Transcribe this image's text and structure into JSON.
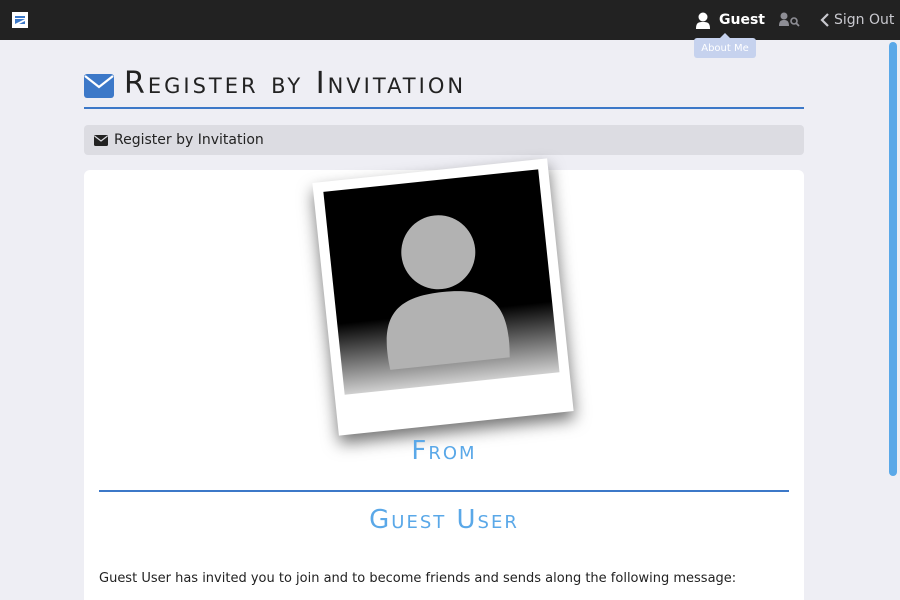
{
  "navbar": {
    "user_label": "Guest",
    "signout_label": "Sign Out",
    "tooltip": "About Me"
  },
  "page": {
    "title": "Register by Invitation",
    "breadcrumb": "Register by Invitation"
  },
  "invite": {
    "from_label": "From",
    "sender_name": "Guest User",
    "message": "Guest User has invited you to join and to become friends and sends along the following message:"
  },
  "colors": {
    "accent": "#3c78c8",
    "heading_blue": "#5aa8e8",
    "navbar": "#222222"
  },
  "icons": {
    "logo": "app-logo-icon",
    "user": "user-icon",
    "search_user": "user-search-icon",
    "signout": "chevron-left-icon",
    "envelope": "envelope-icon"
  }
}
